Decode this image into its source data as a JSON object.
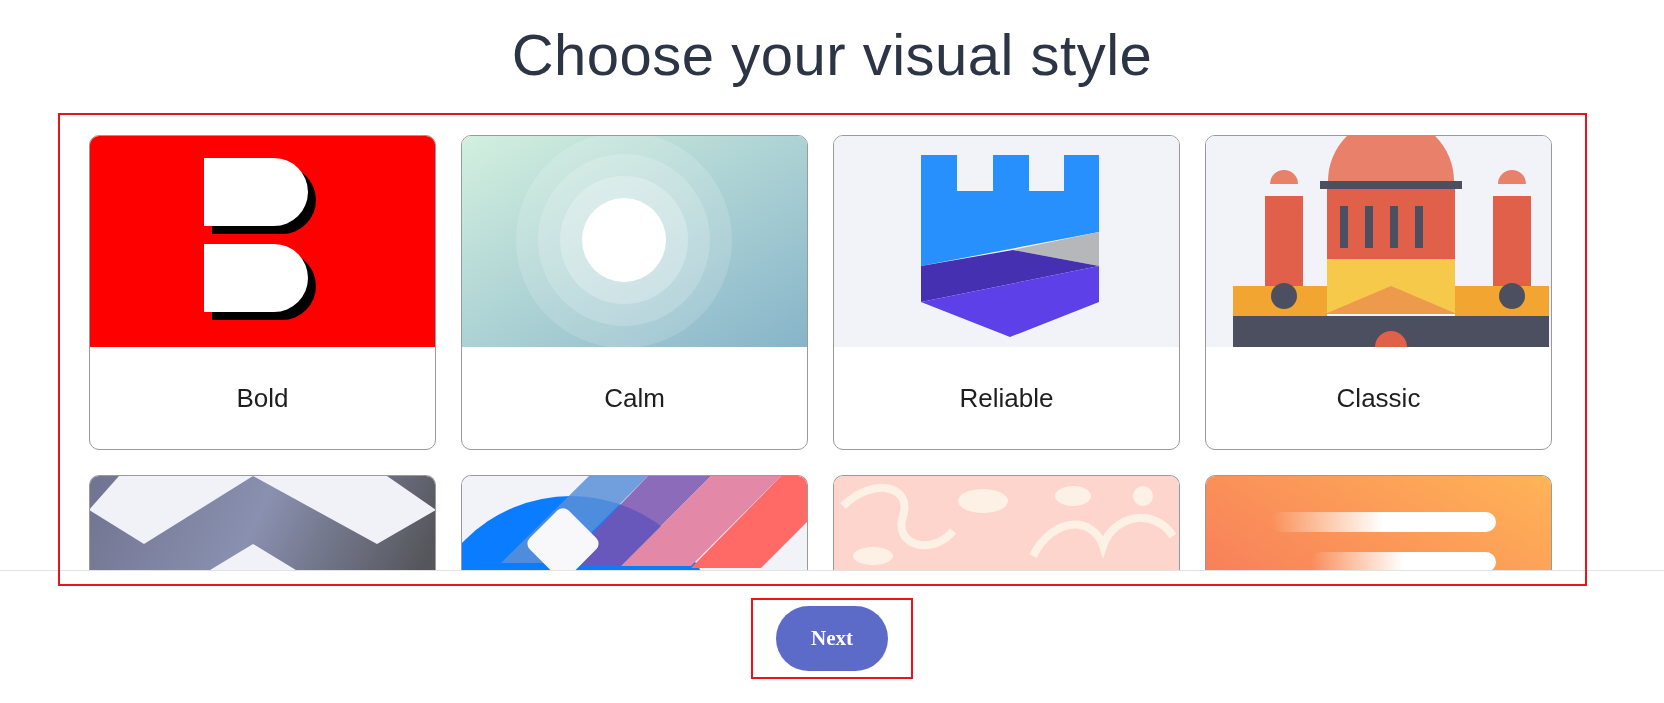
{
  "title": "Choose your visual style",
  "cards": [
    {
      "kind": "labeled",
      "label": "Bold"
    },
    {
      "kind": "labeled",
      "label": "Calm"
    },
    {
      "kind": "labeled",
      "label": "Reliable"
    },
    {
      "kind": "labeled",
      "label": "Classic"
    },
    {
      "kind": "cut"
    },
    {
      "kind": "cut"
    },
    {
      "kind": "cut"
    },
    {
      "kind": "cut"
    }
  ],
  "next_button": "Next"
}
